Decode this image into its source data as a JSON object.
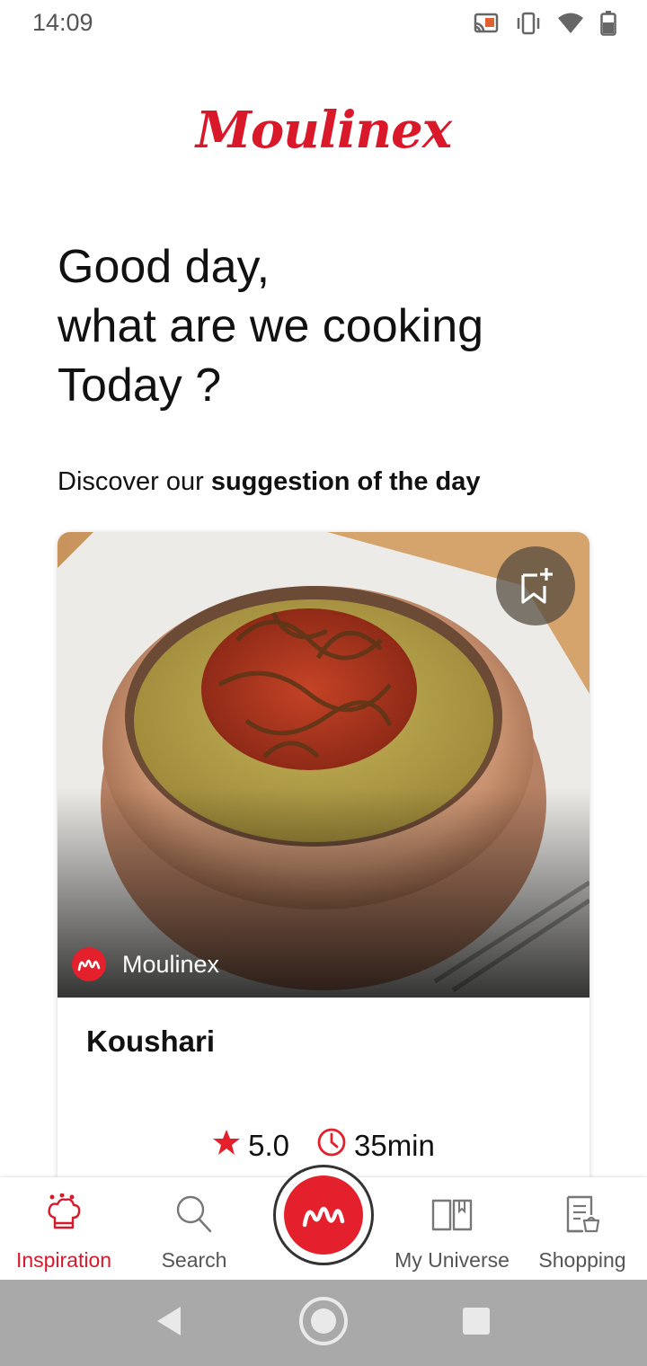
{
  "status_bar": {
    "time": "14:09",
    "icons": [
      "cast-icon",
      "vibrate-icon",
      "wifi-icon",
      "battery-icon"
    ]
  },
  "header": {
    "logo_text": "Moulinex",
    "brand_color": "#d9182a"
  },
  "greeting": {
    "line1": "Good day,",
    "line2": "what are we cooking",
    "line3": "Today ?"
  },
  "discover": {
    "prefix": "Discover our ",
    "emphasis": "suggestion of the day"
  },
  "suggestion_card": {
    "author": "Moulinex",
    "title": "Koushari",
    "rating": "5.0",
    "duration": "35min",
    "bookmark_icon": "bookmark-add-icon"
  },
  "bottom_nav": {
    "items": [
      {
        "label": "Inspiration",
        "icon": "chef-hat-icon",
        "active": true
      },
      {
        "label": "Search",
        "icon": "search-icon",
        "active": false
      },
      {
        "label": "",
        "icon": "moulinex-logo-icon",
        "active": false
      },
      {
        "label": "My Universe",
        "icon": "book-icon",
        "active": false
      },
      {
        "label": "Shopping",
        "icon": "shopping-list-icon",
        "active": false
      }
    ]
  },
  "system_nav": {
    "buttons": [
      "back-icon",
      "home-icon",
      "recents-icon"
    ]
  }
}
